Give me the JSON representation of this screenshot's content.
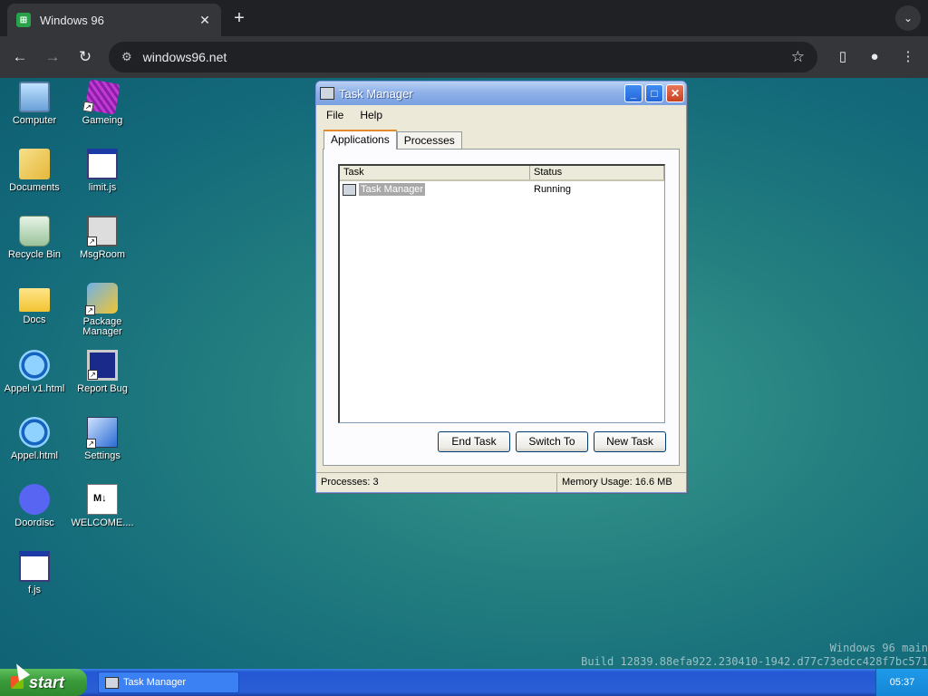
{
  "browser": {
    "tab_title": "Windows 96",
    "tab_close": "✕",
    "newtab": "+",
    "address": "windows96.net",
    "back": "←",
    "forward": "→",
    "reload": "↻",
    "star": "☆",
    "tabsearch": "⌄"
  },
  "desktop": {
    "icons": [
      {
        "label": "Computer"
      },
      {
        "label": "Gameing"
      },
      {
        "label": "Documents"
      },
      {
        "label": "limit.js"
      },
      {
        "label": "Recycle Bin"
      },
      {
        "label": "MsgRoom"
      },
      {
        "label": "Docs"
      },
      {
        "label": "Package Manager"
      },
      {
        "label": "Appel v1.html"
      },
      {
        "label": "Report Bug"
      },
      {
        "label": "Appel.html"
      },
      {
        "label": "Settings"
      },
      {
        "label": "Doordisc"
      },
      {
        "label": "WELCOME...."
      },
      {
        "label": "f.js"
      }
    ],
    "watermark": {
      "line1": "Windows 96 main",
      "line2": "Build 12839.88efa922.230410-1942.d77c73edcc428f7bc571"
    }
  },
  "window": {
    "title": "Task Manager",
    "menu": [
      "File",
      "Help"
    ],
    "tabs": [
      "Applications",
      "Processes"
    ],
    "columns": [
      "Task",
      "Status"
    ],
    "rows": [
      {
        "task": "Task Manager",
        "status": "Running"
      }
    ],
    "buttons": {
      "end_task": "End Task",
      "switch_to": "Switch To",
      "new_task": "New Task"
    },
    "status": {
      "processes": "Processes: 3",
      "memory": "Memory Usage: 16.6 MB"
    }
  },
  "taskbar": {
    "start_label": "start",
    "task_item": "Task Manager",
    "clock": "05:37"
  }
}
